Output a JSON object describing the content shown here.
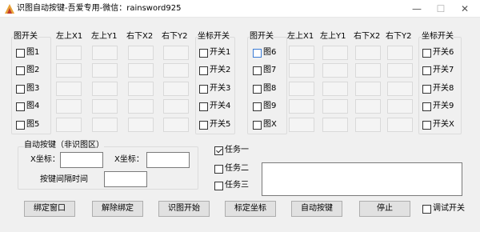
{
  "window": {
    "title": "识图自动按键-吾爱专用-微信：rainsword925",
    "minimize": "—",
    "maximize": "☐",
    "close": "✕"
  },
  "left_panel": {
    "image_group_title": "图开关",
    "headers": [
      "左上X1",
      "左上Y1",
      "右下X2",
      "右下Y2"
    ],
    "switch_group_title": "坐标开关",
    "images": [
      "图1",
      "图2",
      "图3",
      "图4",
      "图5"
    ],
    "switches": [
      "开关1",
      "开关2",
      "开关3",
      "开关4",
      "开关5"
    ]
  },
  "right_panel": {
    "image_group_title": "图开关",
    "headers": [
      "左上X1",
      "左上Y1",
      "右下X2",
      "右下Y2"
    ],
    "switch_group_title": "坐标开关",
    "images": [
      "图6",
      "图7",
      "图8",
      "图9",
      "图X"
    ],
    "switches": [
      "开关6",
      "开关7",
      "开关8",
      "开关9",
      "开关X"
    ]
  },
  "auto_key": {
    "group_title": "自动按键（非识图区）",
    "x_label": "X坐标：",
    "y_label": "X坐标：",
    "interval_label": "按键间隔时间",
    "x_value": "",
    "y_value": "",
    "interval_value": ""
  },
  "tasks": {
    "items": [
      {
        "label": "任务一",
        "checked": true
      },
      {
        "label": "任务二",
        "checked": false
      },
      {
        "label": "任务三",
        "checked": false
      }
    ],
    "log_text": ""
  },
  "buttons": {
    "bind_window": "绑定窗口",
    "unbind": "解除绑定",
    "start_recognition": "识图开始",
    "mark_coords": "标定坐标",
    "auto_key": "自动按键",
    "stop": "停止",
    "debug_switch": "调试开关"
  }
}
